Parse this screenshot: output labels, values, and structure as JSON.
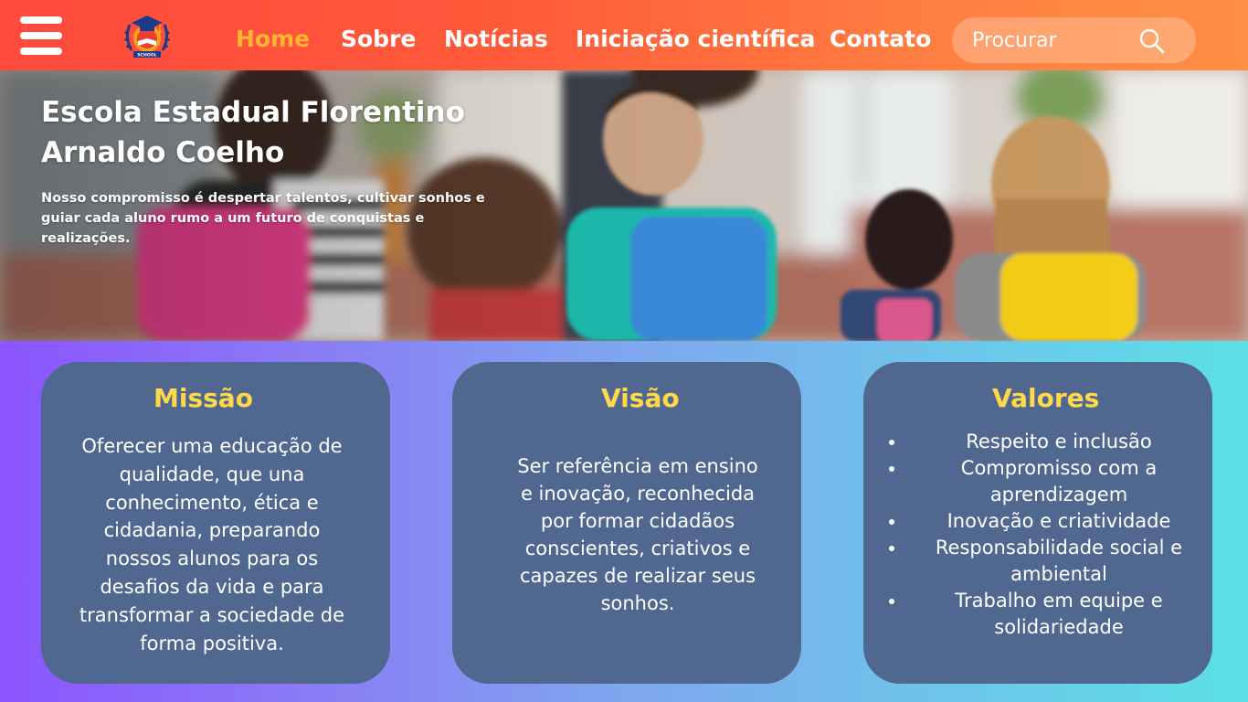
{
  "nav": {
    "menu_icon": "hamburger-menu-icon",
    "logo_icon": "school-graduation-cap-logo",
    "logo_text": "SCHOOL",
    "links": [
      {
        "label": "Home",
        "active": true
      },
      {
        "label": "Sobre",
        "active": false
      },
      {
        "label": "Notícias",
        "active": false
      },
      {
        "label": "Iniciação científica",
        "active": false
      },
      {
        "label": "Contato",
        "active": false
      }
    ],
    "search": {
      "placeholder": "Procurar",
      "icon": "search-icon"
    },
    "colors": {
      "gradient_start": "#ff4a3d",
      "gradient_end": "#ff8f45",
      "active_link": "#ffb733"
    }
  },
  "hero": {
    "title": "Escola Estadual Florentino Arnaldo Coelho",
    "tagline": "Nosso compromisso é despertar talentos, cultivar sonhos e guiar cada aluno rumo a um futuro de conquistas e realizações."
  },
  "cards": {
    "mission": {
      "title": "Missão",
      "text": "Oferecer uma educação de qualidade, que una conhecimento, ética e cidadania, preparando nossos alunos para os desafios da vida e para transformar a sociedade de forma positiva."
    },
    "vision": {
      "title": "Visão",
      "text": "Ser referência em ensino e inovação, reconhecida por formar cidadãos conscientes, criativos e capazes de realizar seus sonhos."
    },
    "values": {
      "title": "Valores",
      "items": [
        "Respeito e inclusão",
        "Compromisso com a aprendizagem",
        "Inovação e criatividade",
        "Responsabilidade social e ambiental",
        "Trabalho em equipe e solidariedade"
      ]
    },
    "colors": {
      "card_bg": "#50688f",
      "title": "#ffd94a",
      "text": "#ffffff"
    }
  }
}
